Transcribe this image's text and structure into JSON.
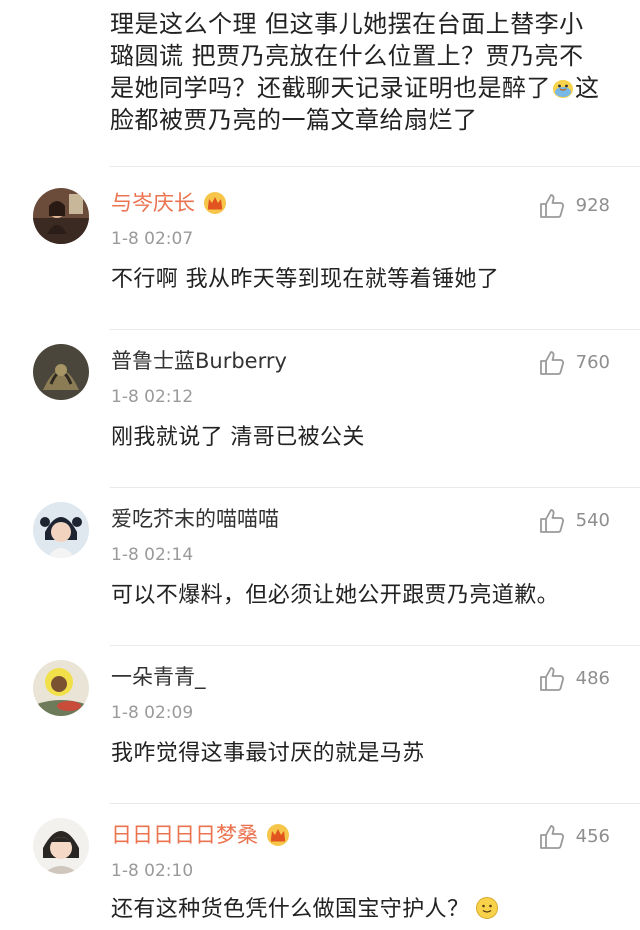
{
  "top_comment": {
    "line1": "理是这么个理 但这事儿她摆在台面上替李小",
    "line2": "璐圆谎 把贾乃亮放在什么位置上？贾乃亮不",
    "line3a": "是她同学吗？还截聊天记录证明也是醉了",
    "line3b": "这",
    "line4": "脸都被贾乃亮的一篇文章给扇烂了"
  },
  "comments": [
    {
      "username": "与岑庆长",
      "vip": true,
      "time": "1-8 02:07",
      "likes": "928",
      "text": "不行啊 我从昨天等到现在就等着锤她了"
    },
    {
      "username": "普鲁士蓝Burberry",
      "vip": false,
      "time": "1-8 02:12",
      "likes": "760",
      "text": "刚我就说了  清哥已被公关"
    },
    {
      "username": "爱吃芥末的喵喵喵",
      "vip": false,
      "time": "1-8 02:14",
      "likes": "540",
      "text": "可以不爆料，但必须让她公开跟贾乃亮道歉。"
    },
    {
      "username": "一朵青青_",
      "vip": false,
      "time": "1-8 02:09",
      "likes": "486",
      "text": "我咋觉得这事最讨厌的就是马苏"
    },
    {
      "username": "日日日日日梦桑",
      "vip": true,
      "time": "1-8 02:10",
      "likes": "456",
      "text": "还有这种货色凭什么做国宝守护人？"
    }
  ],
  "colors": {
    "vip_name": "#eb7350",
    "normal_name": "#333333",
    "meta": "#9a9a9a",
    "divider": "#e9e9e9"
  }
}
